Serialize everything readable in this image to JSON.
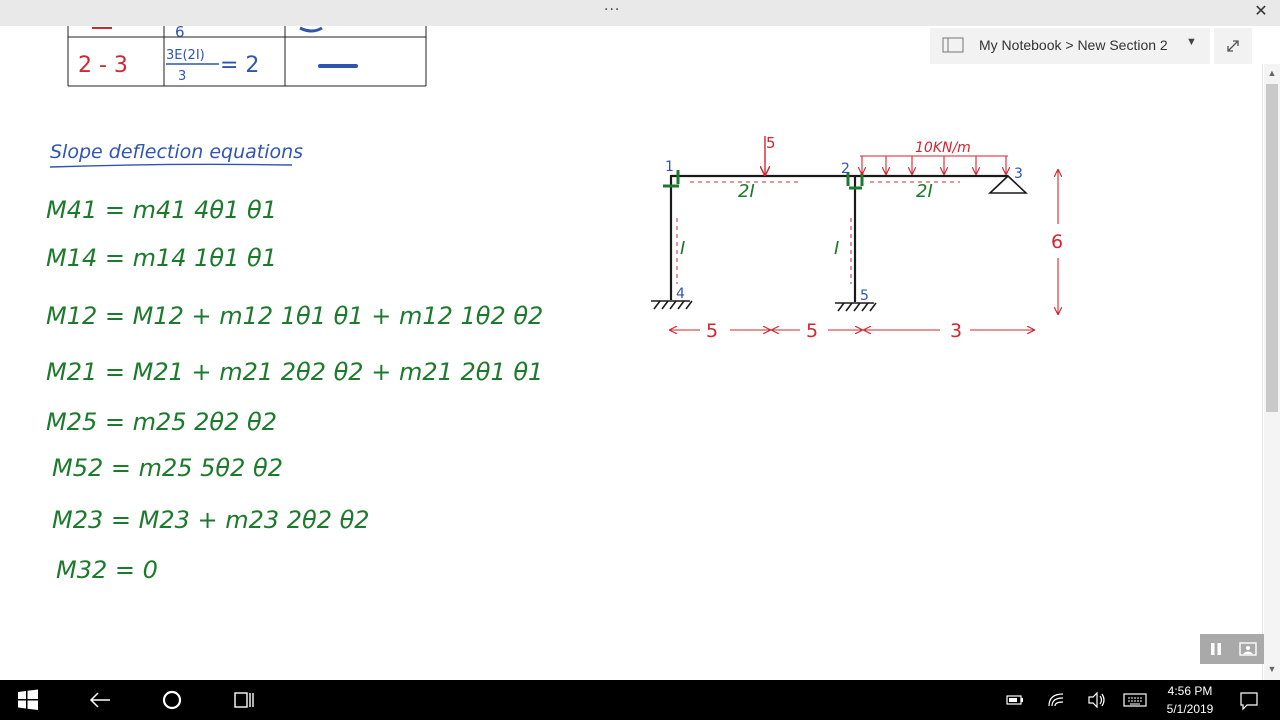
{
  "window": {
    "more_glyph": "···",
    "close_glyph": "✕"
  },
  "notebook": {
    "location": "My Notebook > New Section 2",
    "caret": "▼"
  },
  "scrollbar": {
    "up_glyph": "▲",
    "down_glyph": "▼"
  },
  "table": {
    "row_prev_col2": "6",
    "row_member": "2 - 3",
    "row_formula_num": "3E(2I)",
    "row_formula_den": "3",
    "row_formula_result": "= 2"
  },
  "notes": {
    "heading": "Slope deflection equations",
    "equations": [
      "M41 = m41 4θ1 θ1",
      "M14 = m14 1θ1 θ1",
      "M12 = M12 + m12 1θ1 θ1 + m12 1θ2 θ2",
      "M21 = M21 + m21 2θ2 θ2 + m21 2θ1 θ1",
      "M25 = m25 2θ2 θ2",
      "M52 = m25 5θ2 θ2",
      "M23 = M23 + m23 2θ2 θ2",
      "M32 = 0"
    ]
  },
  "frame": {
    "point_load": "5",
    "udl_label": "10KN/m",
    "beam_12_inertia": "2I",
    "beam_23_inertia": "2I",
    "column_14_inertia": "I",
    "column_25_inertia": "I",
    "joints": [
      "1",
      "2",
      "3",
      "4",
      "5"
    ],
    "spans": [
      "5",
      "5",
      "3"
    ],
    "height": "6"
  },
  "taskbar": {
    "time": "4:56 PM",
    "date": "5/1/2019"
  },
  "colors": {
    "ink_green": "#1c7a2c",
    "ink_red": "#d4252f",
    "ink_blue": "#2f55b3",
    "ink_dark": "#1a1a1a",
    "taskbar": "#000000"
  }
}
